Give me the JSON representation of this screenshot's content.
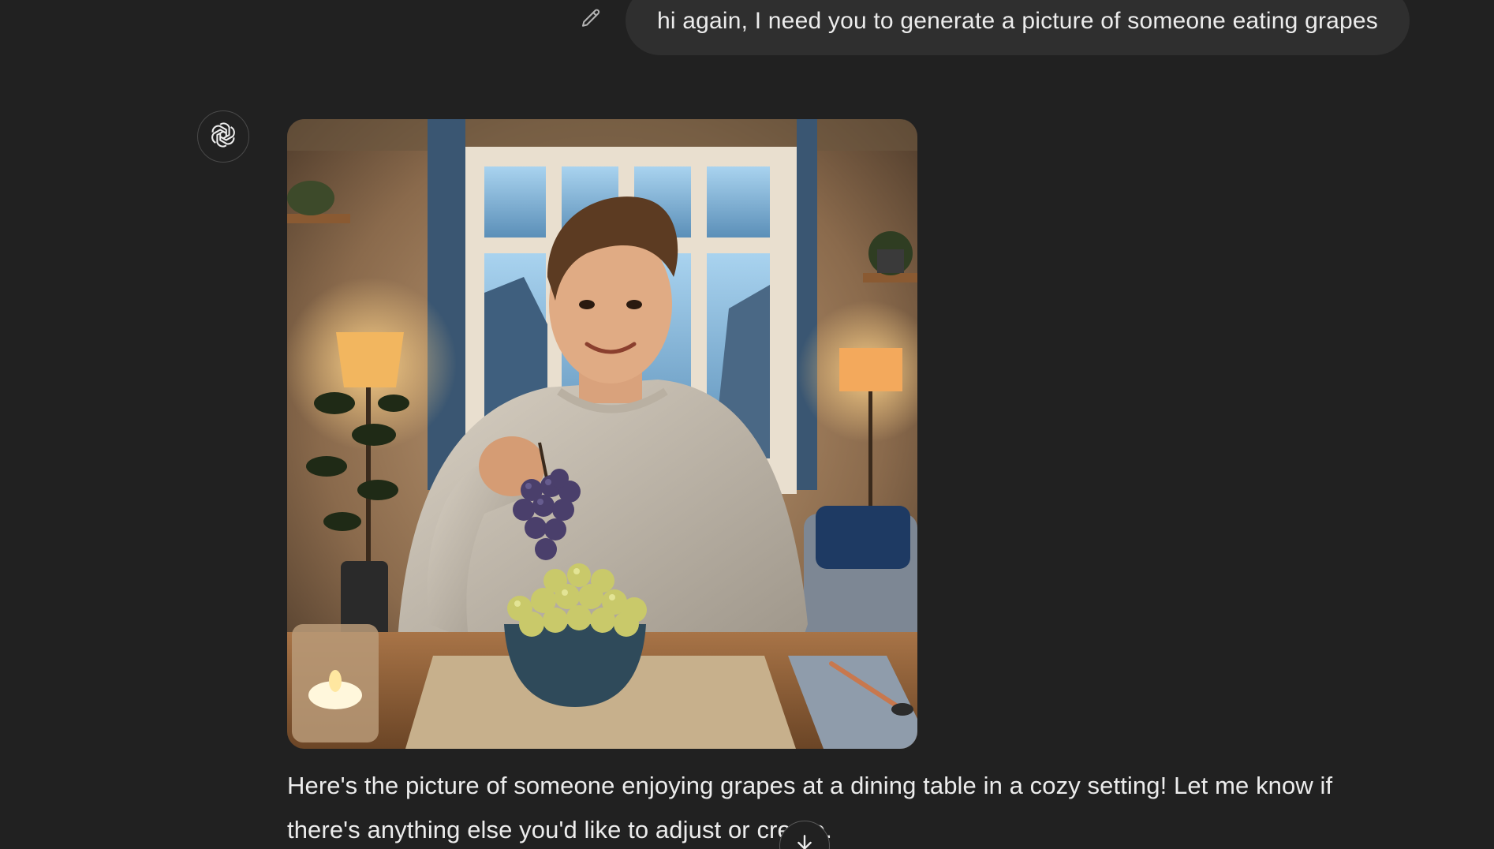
{
  "user_message": {
    "text": "hi again, I need you to generate a picture of someone eating grapes"
  },
  "icons": {
    "edit": "pencil-icon",
    "assistant_avatar": "openai-logo-icon",
    "scroll_down": "arrow-down-icon"
  },
  "assistant_message": {
    "text": "Here's the picture of someone enjoying grapes at a dining table in a cozy setting! Let me know if there's anything else you'd like to adjust or create."
  },
  "colors": {
    "background": "#212121",
    "user_bubble": "#2f2f2f",
    "text": "#ececec"
  }
}
